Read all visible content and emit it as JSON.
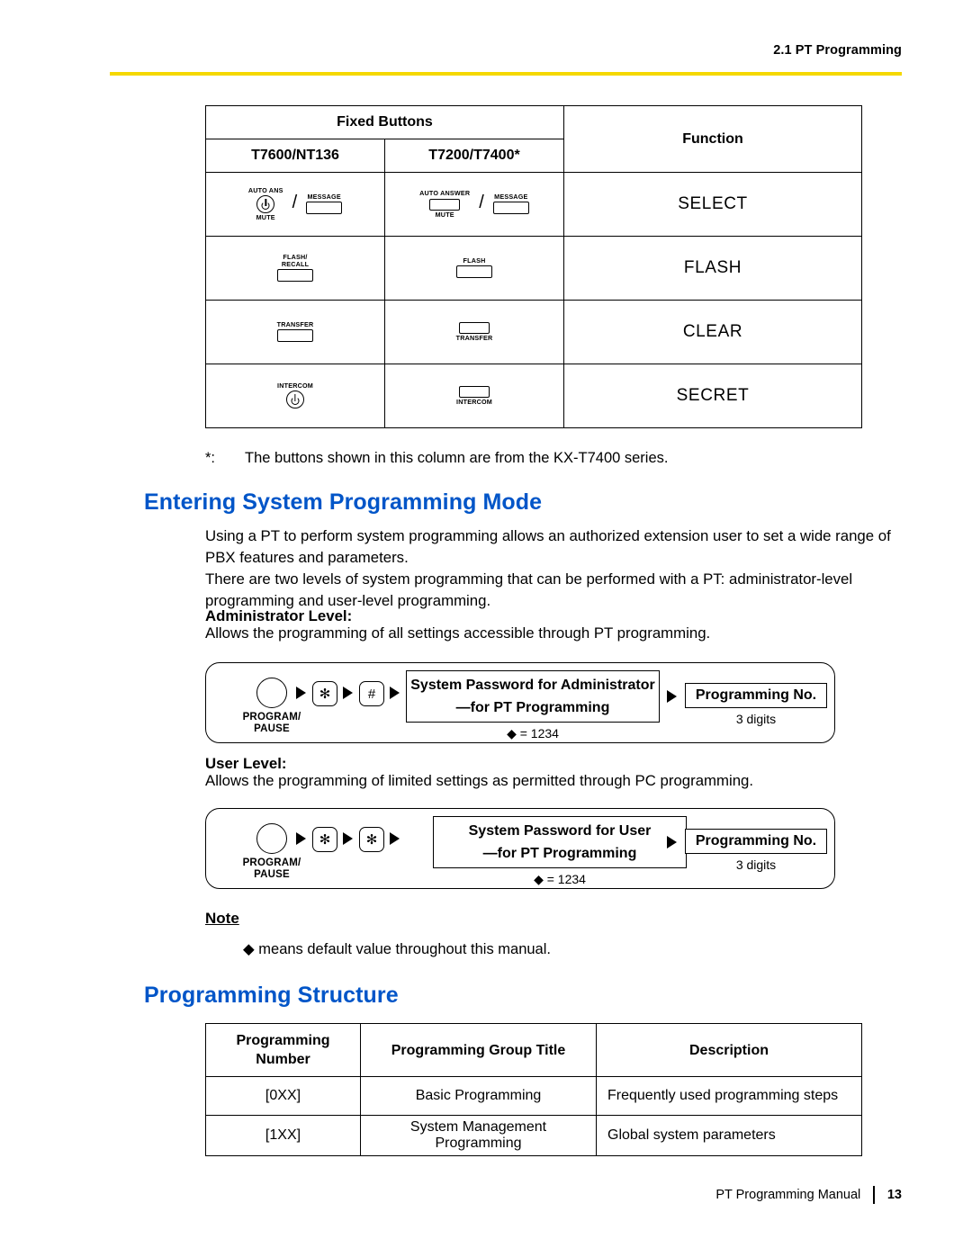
{
  "header": {
    "section": "2.1 PT Programming"
  },
  "fixed_buttons_table": {
    "head_fixed": "Fixed Buttons",
    "head_function": "Function",
    "col_a": "T7600/NT136",
    "col_b": "T7200/T7400*",
    "rows": [
      {
        "function": "SELECT",
        "a_keys": [
          {
            "top": "AUTO ANS",
            "bottom": "MUTE",
            "shape": "round"
          },
          {
            "top": "MESSAGE",
            "bottom": "",
            "shape": "rect"
          }
        ],
        "b_keys": [
          {
            "top": "AUTO ANSWER",
            "bottom": "MUTE",
            "shape": "rect-sm"
          },
          {
            "top": "MESSAGE",
            "bottom": "",
            "shape": "rect"
          }
        ],
        "separator": "/"
      },
      {
        "function": "FLASH",
        "a_keys": [
          {
            "top": "FLASH/\nRECALL",
            "bottom": "",
            "shape": "rect"
          }
        ],
        "b_keys": [
          {
            "top": "FLASH",
            "bottom": "",
            "shape": "rect"
          }
        ],
        "separator": ""
      },
      {
        "function": "CLEAR",
        "a_keys": [
          {
            "top": "TRANSFER",
            "bottom": "",
            "shape": "rect"
          }
        ],
        "b_keys": [
          {
            "top": "",
            "bottom": "TRANSFER",
            "shape": "rect"
          }
        ],
        "separator": ""
      },
      {
        "function": "SECRET",
        "a_keys": [
          {
            "top": "INTERCOM",
            "bottom": "",
            "shape": "round"
          }
        ],
        "b_keys": [
          {
            "top": "",
            "bottom": "INTERCOM",
            "shape": "rect"
          }
        ],
        "separator": ""
      }
    ]
  },
  "footnote": {
    "marker": "*:",
    "text": "The buttons shown in this column are from the KX-T7400 series."
  },
  "entering_mode": {
    "heading": "Entering System Programming Mode",
    "para1": "Using a PT to perform system programming allows an authorized extension user to set a wide range of PBX features and parameters.",
    "para2": "There are two levels of system programming that can be performed with a PT: administrator-level programming and user-level programming.",
    "admin_label": "Administrator Level:",
    "admin_desc": "Allows the programming of all settings accessible through PT programming.",
    "user_label": "User Level:",
    "user_desc": "Allows the programming of limited settings as permitted through PC programming."
  },
  "admin_flow": {
    "program_key_label_1": "PROGRAM/",
    "program_key_label_2": "PAUSE",
    "key1": "✻",
    "key2": "#",
    "password_line1": "System Password for Administrator",
    "password_line2": "—for PT Programming",
    "default_value": "◆ = 1234",
    "prog_no": "Programming No.",
    "digits": "3 digits"
  },
  "user_flow": {
    "program_key_label_1": "PROGRAM/",
    "program_key_label_2": "PAUSE",
    "key1": "✻",
    "key2": "✻",
    "password_line1": "System Password for User",
    "password_line2": "—for PT Programming",
    "default_value": "◆ = 1234",
    "prog_no": "Programming No.",
    "digits": "3 digits"
  },
  "note": {
    "title": "Note",
    "text": "◆ means default value throughout this manual."
  },
  "programming_structure": {
    "heading": "Programming Structure",
    "headers": [
      "Programming\nNumber",
      "Programming Group Title",
      "Description"
    ],
    "header_num_line1": "Programming",
    "header_num_line2": "Number",
    "header_title": "Programming Group Title",
    "header_desc": "Description",
    "rows": [
      {
        "number": "[0XX]",
        "title": "Basic Programming",
        "title_line2": "",
        "description": "Frequently used programming steps"
      },
      {
        "number": "[1XX]",
        "title": "System Management",
        "title_line2": "Programming",
        "description": "Global system parameters"
      }
    ]
  },
  "footer": {
    "manual": "PT Programming Manual",
    "page": "13"
  },
  "colors": {
    "heading_blue": "#0055c8",
    "rule_yellow": "#f5d800"
  }
}
